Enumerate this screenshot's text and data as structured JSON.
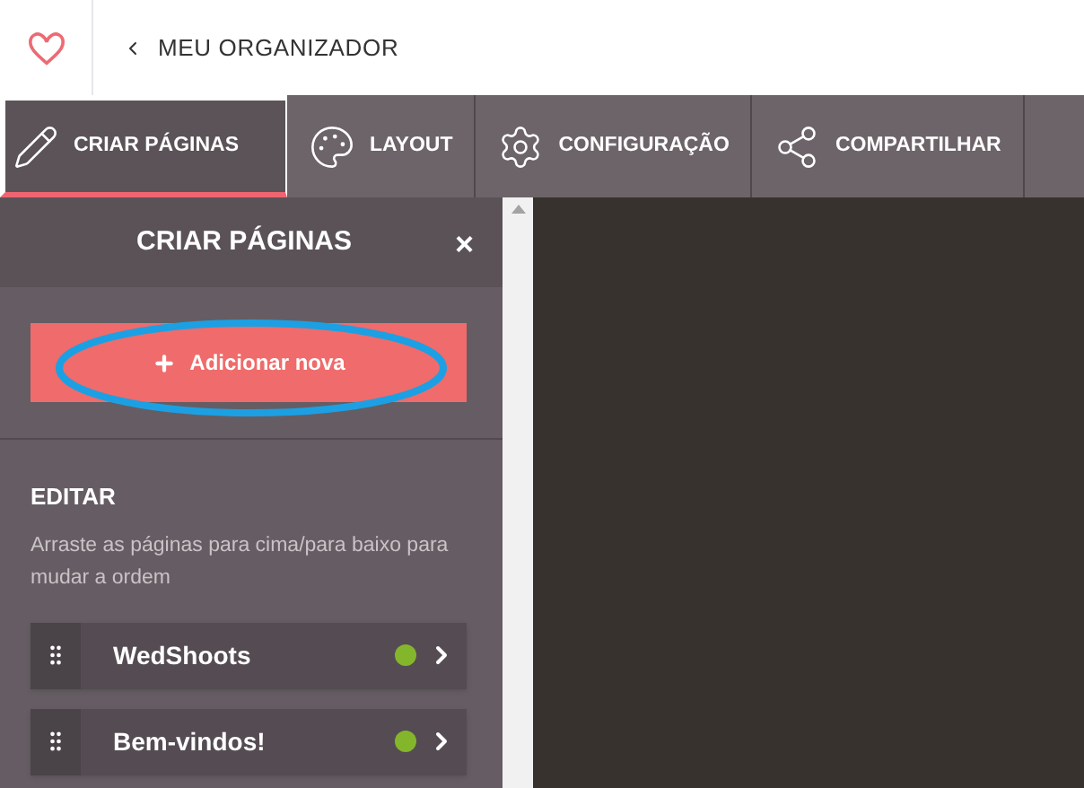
{
  "header": {
    "back_label": "MEU ORGANIZADOR"
  },
  "nav_tabs": [
    {
      "label": "CRIAR PÁGINAS",
      "selected": true
    },
    {
      "label": "LAYOUT",
      "selected": false
    },
    {
      "label": "CONFIGURAÇÃO",
      "selected": false
    },
    {
      "label": "COMPARTILHAR",
      "selected": false
    }
  ],
  "panel": {
    "title": "CRIAR PÁGINAS",
    "close": "×",
    "add_button": {
      "label": "Adicionar nova",
      "circled": true
    },
    "section_title": "EDITAR",
    "hint": "Arraste as páginas para cima/para baixo para mudar a ordem",
    "pages": [
      {
        "name": "WedShoots",
        "color": "#84b62c"
      },
      {
        "name": "Bem-vindos!",
        "color": "#84b62c"
      }
    ]
  }
}
